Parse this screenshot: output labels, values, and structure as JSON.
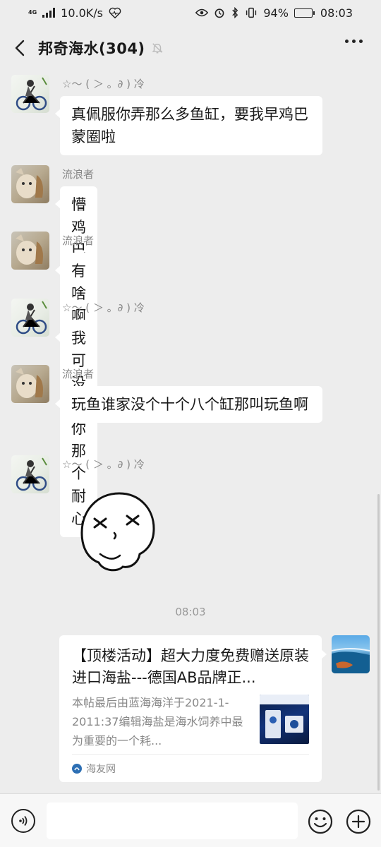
{
  "status_bar": {
    "network_type": "4G",
    "speed": "10.0K/s",
    "battery": "94%",
    "battery_level": 0.94,
    "time": "08:03"
  },
  "header": {
    "title": "邦奇海水(304)"
  },
  "messages": [
    {
      "sender": "☆～ ( ＞ 。∂ ) 冷",
      "text": "真佩服你弄那么多鱼缸，要我早鸡巴蒙圈啦"
    },
    {
      "sender": "流浪者",
      "text": "懵鸡巴啊"
    },
    {
      "sender": "流浪者",
      "text": "有啥啊"
    },
    {
      "sender": "☆～ ( ＞ 。∂ ) 冷",
      "text": "我可没有你那个耐心"
    },
    {
      "sender": "流浪者",
      "text": "玩鱼谁家没个十个八个缸那叫玩鱼啊"
    },
    {
      "sender": "☆～ ( ＞ 。∂ ) 冷",
      "sticker": "embarrassed-face-sticker"
    }
  ],
  "timestamp": "08:03",
  "link_card": {
    "title": "【顶楼活动】超大力度免费赠送原装进口海盐---德国AB品牌正...",
    "description": "本帖最后由蓝海海洋于2021-1-2011:37编辑海盐是海水饲养中最为重要的一个耗...",
    "source": "海友网"
  },
  "colors": {
    "background": "#ededed",
    "bubble": "#ffffff",
    "nickname": "#888888"
  }
}
